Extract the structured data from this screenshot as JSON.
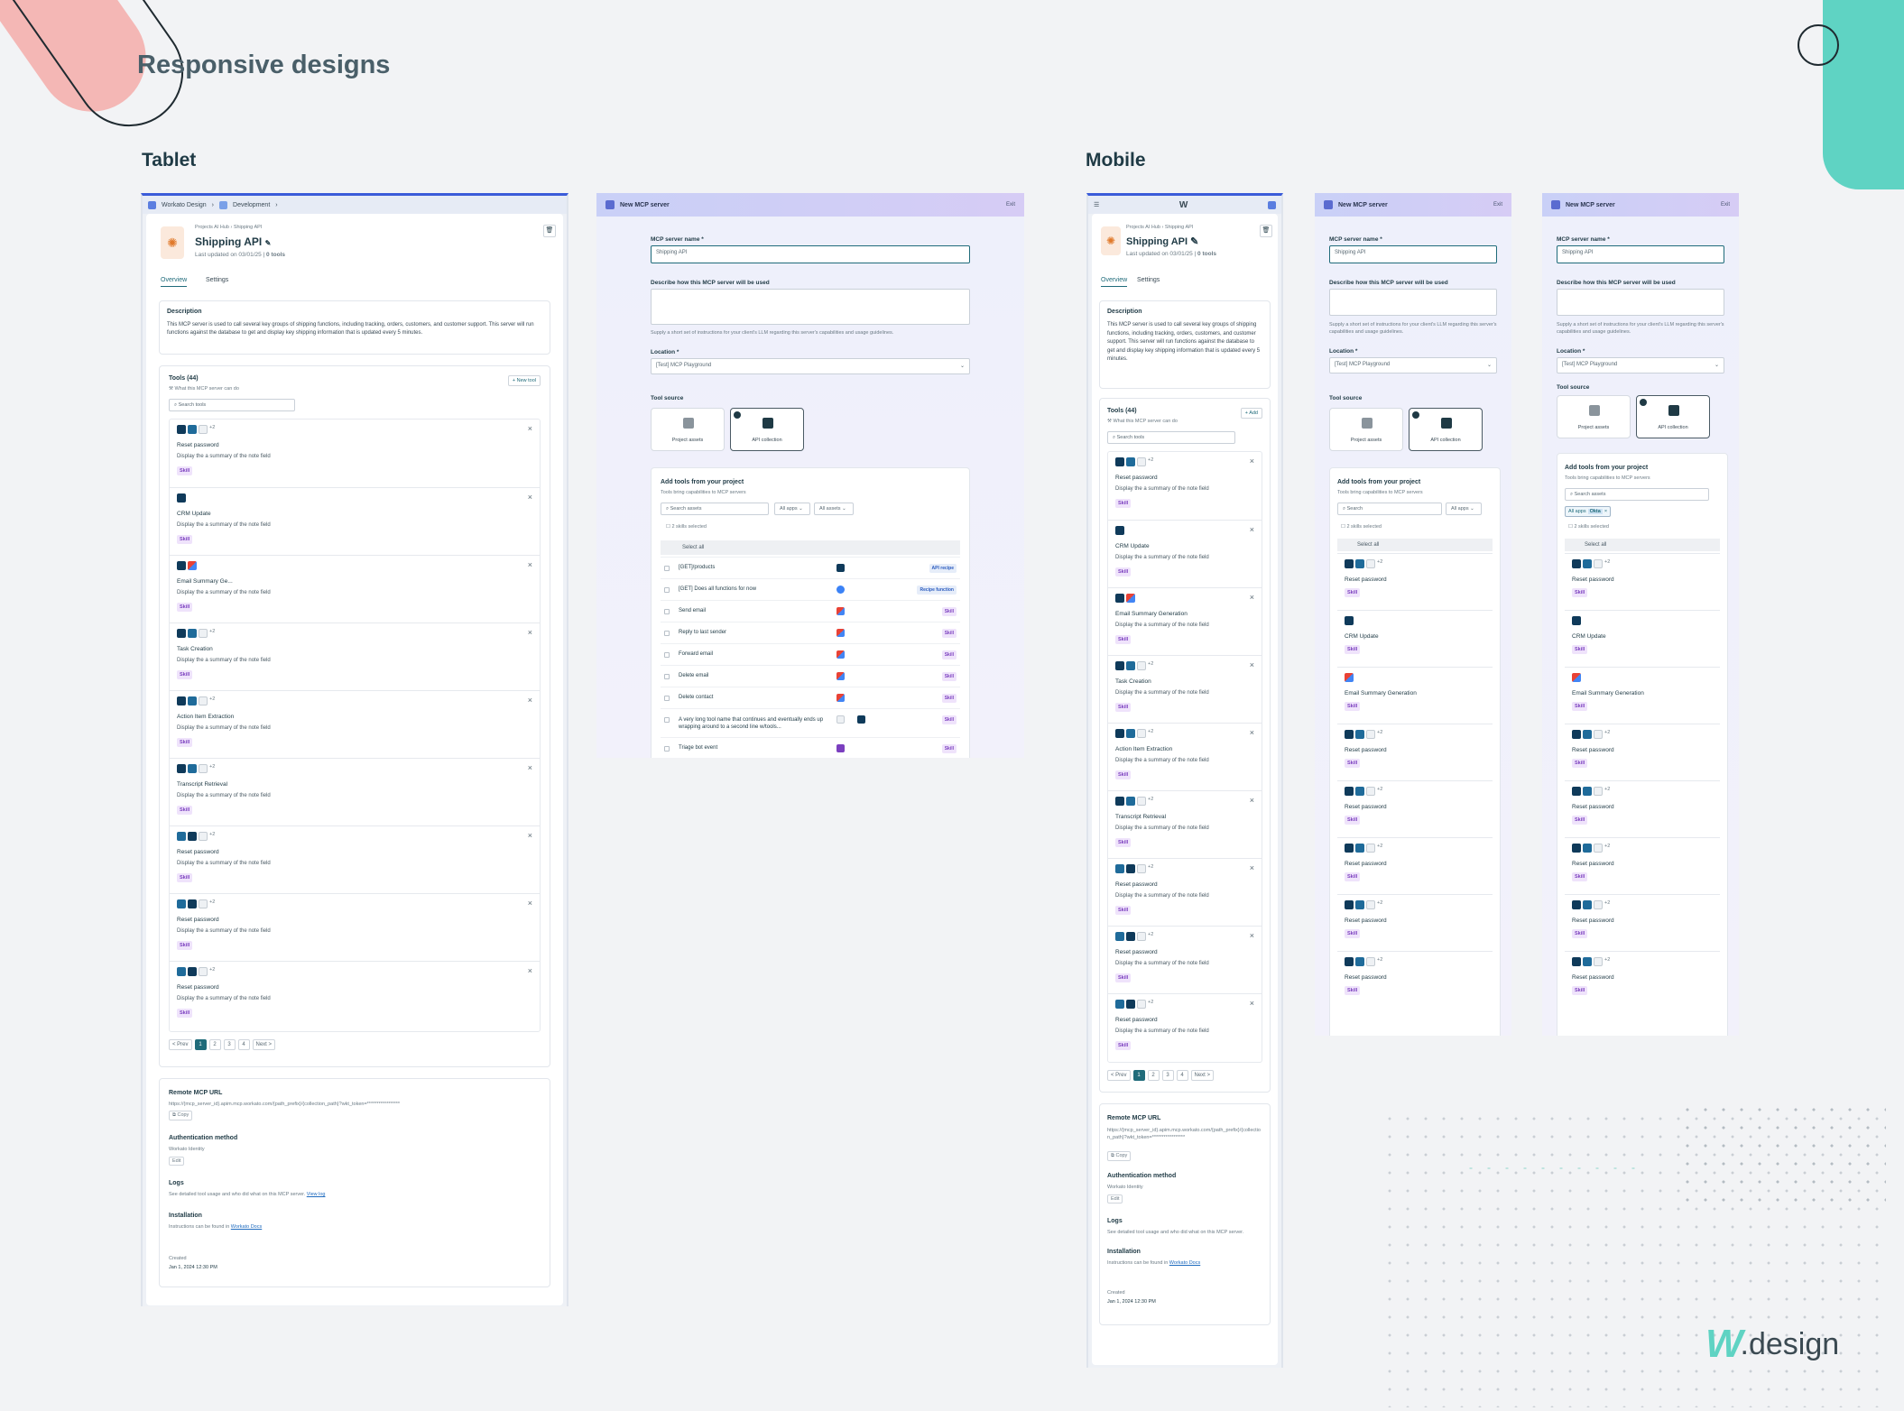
{
  "page": {
    "title": "Responsive designs",
    "tablet": "Tablet",
    "mobile": "Mobile",
    "brand_suffix": ".design"
  },
  "crumbs": {
    "workato": "Workato Design",
    "dev": "Development",
    "path": "Projects AI Hub",
    "path2": "Shipping API"
  },
  "server": {
    "name": "Shipping API",
    "updated": "Last updated on 03/01/25",
    "tools_count": "0 tools",
    "tabs": [
      "Overview",
      "Settings"
    ],
    "desc_title": "Description",
    "desc": "This MCP server is used to call several key groups of shipping functions, including tracking, orders, customers, and customer support. This server will run functions against the database to get and display key shipping information that is updated every 5 minutes.",
    "tools_title": "Tools (44)",
    "tools_sub": "What this MCP server can do",
    "new_tool": "+ New tool",
    "add": "+ Add",
    "search_tools": "Search tools",
    "tool_desc": "Display the a summary of the note field",
    "skill": "Skill",
    "tools": [
      "Reset password",
      "CRM Update",
      "Email Summary Ge...",
      "Task Creation",
      "Action Item Extraction",
      "Transcript Retrieval",
      "Reset password",
      "Reset password",
      "Reset password"
    ],
    "tools_mobile": [
      "Reset password",
      "CRM Update",
      "Email Summary Generation",
      "Task Creation",
      "Action Item Extraction",
      "Transcript Retrieval",
      "Reset password",
      "Reset password",
      "Reset password"
    ],
    "pager": [
      "< Prev",
      "1",
      "2",
      "3",
      "4",
      "Next >"
    ],
    "remote_title": "Remote MCP URL",
    "remote_url": "https://{mcp_server_id}.apim.mcp.workato.com/{path_prefix}/{collection_path}?wkt_token=*****************",
    "copy": "Copy",
    "auth_title": "Authentication method",
    "auth_value": "Workato Identity",
    "edit": "Edit",
    "logs_title": "Logs",
    "logs_desc": "See detailed tool usage and who did what on this MCP server.",
    "view_log": "View log",
    "install_title": "Installation",
    "install_desc": "Instructions can be found in",
    "docs": "Workato Docs",
    "created_label": "Created",
    "created": "Jan 1, 2024 12:30 PM"
  },
  "modal": {
    "title": "New MCP server",
    "exit": "Exit",
    "name_label": "MCP server name *",
    "name_value": "Shipping API",
    "describe_label": "Describe how this MCP server will be used",
    "describe_hint": "Supply a short set of instructions for your client's LLM regarding this server's capabilities and usage guidelines.",
    "location_label": "Location *",
    "location_value": "[Test] MCP Playground",
    "source_label": "Tool source",
    "src_project": "Project assets",
    "src_api": "API collection",
    "add_title": "Add tools from your project",
    "add_sub": "Tools bring capabilities to MCP servers",
    "search_assets": "Search assets",
    "all_apps": "All apps",
    "all_assets": "All assets",
    "selected": "2 skills selected",
    "select_all": "Select all",
    "rows": [
      {
        "name": "[GET]/products",
        "tag": "API recipe"
      },
      {
        "name": "[GET] Does all functions for now",
        "tag": "Recipe function"
      },
      {
        "name": "Send email",
        "tag": "Skill"
      },
      {
        "name": "Reply to last sender",
        "tag": "Skill"
      },
      {
        "name": "Forward email",
        "tag": "Skill"
      },
      {
        "name": "Delete email",
        "tag": "Skill"
      },
      {
        "name": "Delete contact",
        "tag": "Skill"
      },
      {
        "name": "A very long tool name that continues and eventually ends up wrapping around to a second line w/tools...",
        "tag": "Skill"
      },
      {
        "name": "Triage bot event",
        "tag": "Skill"
      }
    ],
    "mob_rows": [
      "Reset password",
      "CRM Update",
      "Email Summary Generation",
      "Reset password",
      "Reset password",
      "Reset password",
      "Reset password",
      "Reset password"
    ],
    "search": "Search",
    "chip": "Okta"
  }
}
